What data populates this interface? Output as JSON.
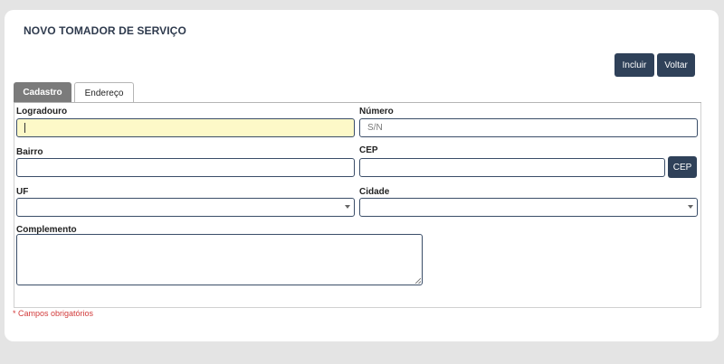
{
  "page": {
    "title": "NOVO TOMADOR DE SERVIÇO",
    "required_note": "* Campos obrigatórios"
  },
  "toolbar": {
    "incluir_label": "Incluir",
    "voltar_label": "Voltar"
  },
  "tabs": [
    {
      "label": "Cadastro",
      "active": true
    },
    {
      "label": "Endereço",
      "active": false
    }
  ],
  "form": {
    "logradouro": {
      "label": "Logradouro",
      "value": "",
      "placeholder": ""
    },
    "numero": {
      "label": "Número",
      "value": "",
      "placeholder": "S/N"
    },
    "bairro": {
      "label": "Bairro",
      "value": "",
      "placeholder": ""
    },
    "cep": {
      "label": "CEP",
      "value": "",
      "placeholder": "",
      "button_label": "CEP"
    },
    "uf": {
      "label": "UF",
      "selected": ""
    },
    "cidade": {
      "label": "Cidade",
      "selected": ""
    },
    "complemento": {
      "label": "Complemento",
      "value": ""
    }
  },
  "colors": {
    "primary_button": "#2f4159",
    "active_tab": "#7b7b7b",
    "focused_field": "#fdf9c8",
    "required_text": "#d23b3b"
  }
}
